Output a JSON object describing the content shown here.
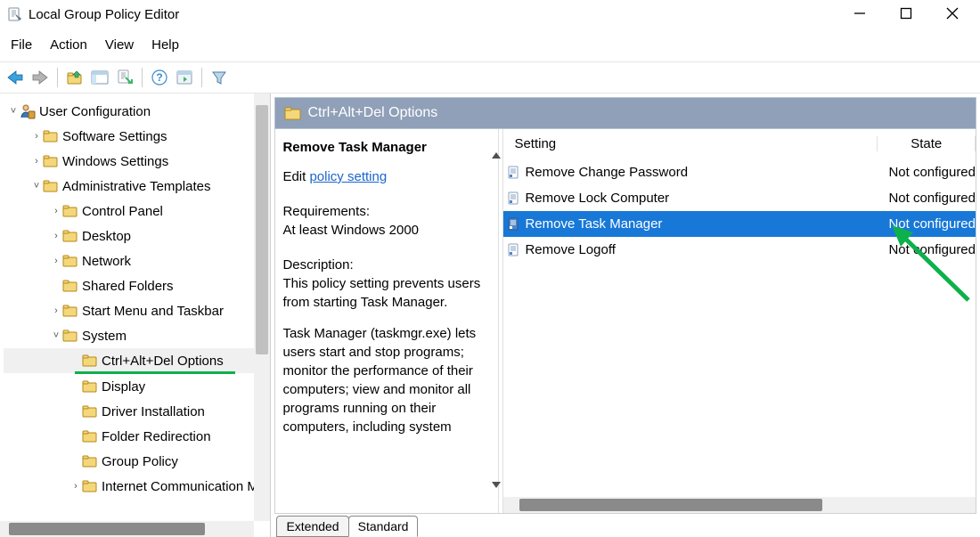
{
  "window": {
    "title": "Local Group Policy Editor"
  },
  "menu": {
    "items": [
      "File",
      "Action",
      "View",
      "Help"
    ]
  },
  "tree": {
    "root": {
      "label": "User Configuration",
      "expanded": true
    },
    "items": [
      {
        "depth": 1,
        "label": "Software Settings",
        "twisty": ">"
      },
      {
        "depth": 1,
        "label": "Windows Settings",
        "twisty": ">"
      },
      {
        "depth": 1,
        "label": "Administrative Templates",
        "twisty": "v",
        "expanded": true
      },
      {
        "depth": 2,
        "label": "Control Panel",
        "twisty": ">"
      },
      {
        "depth": 2,
        "label": "Desktop",
        "twisty": ">"
      },
      {
        "depth": 2,
        "label": "Network",
        "twisty": ">"
      },
      {
        "depth": 2,
        "label": "Shared Folders",
        "twisty": ""
      },
      {
        "depth": 2,
        "label": "Start Menu and Taskbar",
        "twisty": ">"
      },
      {
        "depth": 2,
        "label": "System",
        "twisty": "v",
        "expanded": true
      },
      {
        "depth": 3,
        "label": "Ctrl+Alt+Del Options",
        "twisty": "",
        "selected": true,
        "highlighted": true
      },
      {
        "depth": 3,
        "label": "Display",
        "twisty": ""
      },
      {
        "depth": 3,
        "label": "Driver Installation",
        "twisty": ""
      },
      {
        "depth": 3,
        "label": "Folder Redirection",
        "twisty": ""
      },
      {
        "depth": 3,
        "label": "Group Policy",
        "twisty": ""
      },
      {
        "depth": 3,
        "label": "Internet Communication Ma",
        "twisty": ">"
      }
    ]
  },
  "right": {
    "header": "Ctrl+Alt+Del Options",
    "desc": {
      "title": "Remove Task Manager",
      "edit_prefix": "Edit ",
      "edit_link": "policy setting",
      "req_label": "Requirements:",
      "req_text": "At least Windows 2000",
      "desc_label": "Description:",
      "desc_text1": "This policy setting prevents users from starting Task Manager.",
      "desc_text2": "Task Manager (taskmgr.exe) lets users start and stop programs; monitor the performance of their computers; view and monitor all programs running on their computers, including system"
    },
    "columns": {
      "setting": "Setting",
      "state": "State"
    },
    "settings": [
      {
        "label": "Remove Change Password",
        "state": "Not configured"
      },
      {
        "label": "Remove Lock Computer",
        "state": "Not configured"
      },
      {
        "label": "Remove Task Manager",
        "state": "Not configured",
        "selected": true
      },
      {
        "label": "Remove Logoff",
        "state": "Not configured"
      }
    ]
  },
  "tabs": {
    "extended": "Extended",
    "standard": "Standard"
  }
}
